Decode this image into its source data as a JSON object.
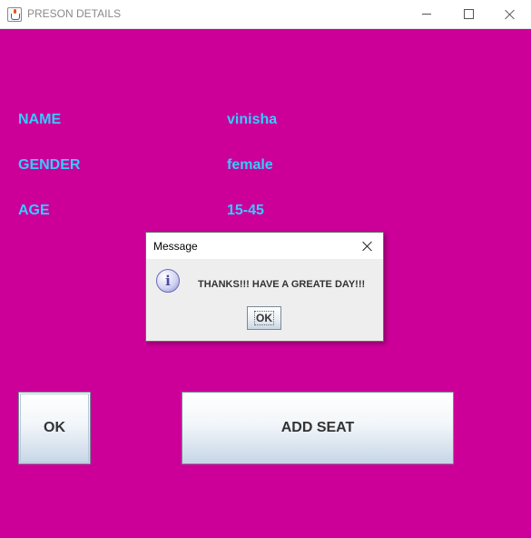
{
  "window": {
    "title": "PRESON DETAILS",
    "icon": "java-cup-icon",
    "controls": [
      "minimize-icon",
      "maximize-icon",
      "close-icon"
    ]
  },
  "colors": {
    "panel_background": "#cc0099",
    "label_text": "#33ccff",
    "button_text": "#333333"
  },
  "fields": [
    {
      "label": "NAME",
      "value": "vinisha"
    },
    {
      "label": "GENDER",
      "value": "female"
    },
    {
      "label": "AGE",
      "value": "15-45"
    }
  ],
  "buttons": {
    "ok_label": "OK",
    "add_seat_label": "ADD SEAT"
  },
  "dialog": {
    "title": "Message",
    "icon": "information-icon",
    "message": "THANKS!!! HAVE A GREATE DAY!!!",
    "ok_label": "OK"
  }
}
